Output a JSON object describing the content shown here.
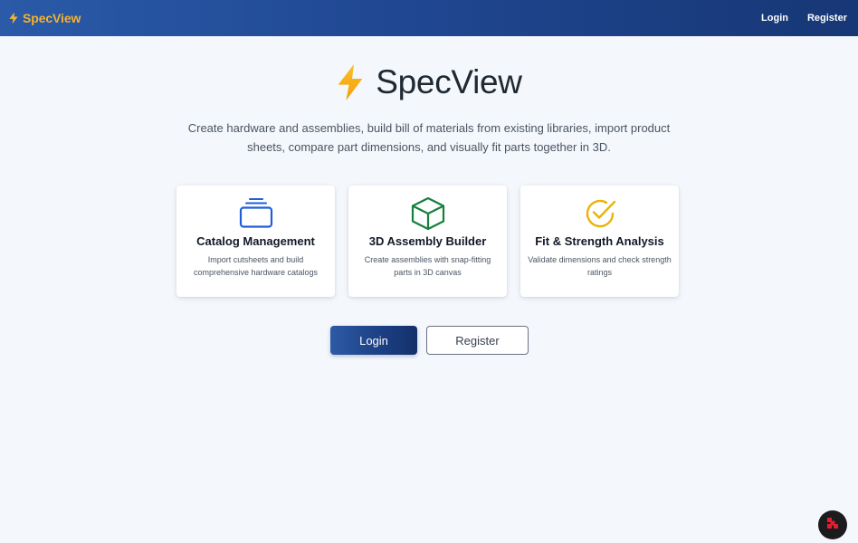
{
  "navbar": {
    "brand_icon": "bolt-icon",
    "brand_label": "SpecView",
    "login_label": "Login",
    "register_label": "Register",
    "brand_color": "#f5b22c"
  },
  "hero": {
    "icon": "bolt-icon",
    "title": "SpecView",
    "subtitle": "Create hardware and assemblies, build bill of materials from existing libraries, import product sheets, compare part dimensions, and visually fit parts together in 3D."
  },
  "features": [
    {
      "icon": "layers-stack-icon",
      "icon_color": "#1d5fd9",
      "title": "Catalog Management",
      "description": "Import cutsheets and build comprehensive hardware catalogs"
    },
    {
      "icon": "cube-icon",
      "icon_color": "#15803d",
      "title": "3D Assembly Builder",
      "description": "Create assemblies with snap-fitting parts in 3D canvas"
    },
    {
      "icon": "check-circle-icon",
      "icon_color": "#eab308",
      "title": "Fit & Strength Analysis",
      "description": "Validate dimensions and check strength ratings"
    }
  ],
  "actions": {
    "login_label": "Login",
    "register_label": "Register"
  },
  "corner_widget": {
    "icon": "app-logo-icon"
  }
}
